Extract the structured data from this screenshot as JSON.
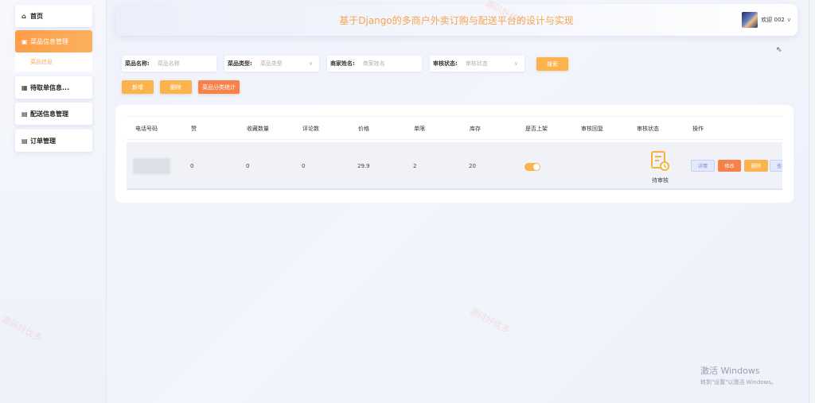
{
  "header": {
    "title": "基于Django的多商户外卖订购与配送平台的设计与实现",
    "welcome": "欢迎 002",
    "caret": "∨"
  },
  "sidebar": {
    "items": [
      {
        "icon": "⌂",
        "label": "首页"
      },
      {
        "icon": "▣",
        "label": "菜品信息管理"
      },
      {
        "icon": "▦",
        "label": "待取单信息..."
      },
      {
        "icon": "▤",
        "label": "配送信息管理"
      },
      {
        "icon": "▤",
        "label": "订单管理"
      }
    ],
    "sub_item": "菜品信息"
  },
  "filters": {
    "dish_name_label": "菜品名称:",
    "dish_name_placeholder": "菜品名称",
    "dish_type_label": "菜品类型:",
    "dish_type_placeholder": "菜品类型",
    "merchant_label": "商家姓名:",
    "merchant_placeholder": "商家姓名",
    "audit_label": "审核状态:",
    "audit_placeholder": "审核状态",
    "search_button": "搜索"
  },
  "toolbar": {
    "add_button": "新增",
    "delete_button": "删除",
    "stats_button": "菜品分类统计"
  },
  "table": {
    "headers": [
      "电话号码",
      "赞",
      "收藏数量",
      "评论数",
      "价格",
      "单限",
      "库存",
      "是否上架",
      "审核回复",
      "审核状态",
      "操作"
    ],
    "row": {
      "likes": "0",
      "favorites": "0",
      "comments": "0",
      "price": "29.9",
      "limit": "2",
      "stock": "20",
      "audit_status": "待审核"
    },
    "actions": {
      "detail": "详情",
      "edit": "修改",
      "delete": "删除",
      "view": "查看"
    }
  },
  "watermark": "源码好伐多",
  "activation": {
    "title": "激活 Windows",
    "subtitle": "转到\"设置\"以激活 Windows。"
  },
  "colors": {
    "accent": "#fbb44d",
    "accent_dark": "#f7814a",
    "title": "#f7a54e"
  }
}
